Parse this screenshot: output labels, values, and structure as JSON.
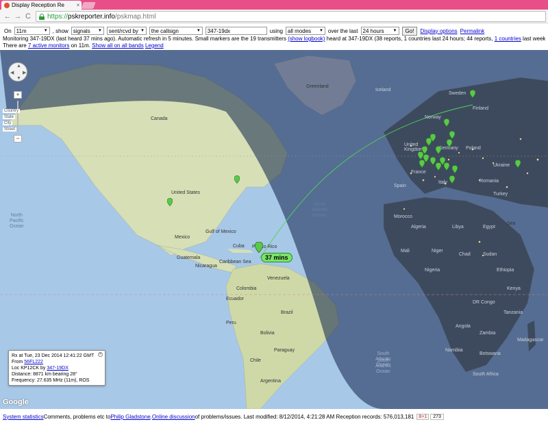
{
  "browser": {
    "tab_title": "Display Reception Re",
    "tab_close": "×",
    "url_scheme": "https://",
    "url_host": "pskreporter.info",
    "url_path": "/pskmap.html",
    "nav_back": "←",
    "nav_forward": "→",
    "nav_reload": "C"
  },
  "controls": {
    "on_label": "On",
    "band": "11m",
    "show_label": ", show",
    "show": "signals",
    "direction": "sent/rcvd by",
    "target": "the callsign",
    "callsign": "347-19dx",
    "using_label": "using",
    "mode": "all modes",
    "over_label": "over the last",
    "period": "24 hours",
    "go": "Go!",
    "display_options": "Display options",
    "permalink": "Permalink"
  },
  "info": {
    "line1_a": "Monitoring 347-19DX (last heard 37 mins ago). Automatic refresh in 5 minutes. Small markers are the 19 transmitters ",
    "line1_link": "(show logbook)",
    "line1_b": " heard at 347-19DX (38 reports, 1 countries last 24 hours; 44 reports, ",
    "line1_link2": "1 countries",
    "line1_c": " last week).",
    "line2_a": "There are ",
    "line2_link": "7 active monitors",
    "line2_b": " on 11m. ",
    "line2_link2": "Show all on all bands",
    "line2_link3": "Legend"
  },
  "map": {
    "labels": [
      {
        "text": "Greenland",
        "cls": ""
      },
      {
        "text": "Canada",
        "cls": ""
      },
      {
        "text": "United States",
        "cls": ""
      },
      {
        "text": "Mexico",
        "cls": ""
      },
      {
        "text": "Venezuela",
        "cls": ""
      },
      {
        "text": "Colombia",
        "cls": ""
      },
      {
        "text": "Peru",
        "cls": ""
      },
      {
        "text": "Brazil",
        "cls": ""
      },
      {
        "text": "Bolivia",
        "cls": ""
      },
      {
        "text": "Paraguay",
        "cls": ""
      },
      {
        "text": "Chile",
        "cls": ""
      },
      {
        "text": "Argentina",
        "cls": ""
      },
      {
        "text": "Ecuador",
        "cls": ""
      },
      {
        "text": "Cuba",
        "cls": ""
      },
      {
        "text": "Puerto Rico",
        "cls": ""
      },
      {
        "text": "Caribbean Sea",
        "cls": ""
      },
      {
        "text": "Gulf of Mexico",
        "cls": ""
      },
      {
        "text": "Guatemala",
        "cls": ""
      },
      {
        "text": "Nicaragua",
        "cls": ""
      },
      {
        "text": "North\nPacific\nOcean",
        "cls": "ocean"
      },
      {
        "text": "North\nAtlantic\nOcean",
        "cls": "ocean"
      },
      {
        "text": "South\nAtlantic\nOcean",
        "cls": "nocean"
      },
      {
        "text": "Iceland",
        "cls": "night"
      },
      {
        "text": "Sweden",
        "cls": "night"
      },
      {
        "text": "Finland",
        "cls": "night"
      },
      {
        "text": "Norway",
        "cls": "night"
      },
      {
        "text": "United\nKingdom",
        "cls": "night"
      },
      {
        "text": "Germany",
        "cls": "night"
      },
      {
        "text": "Poland",
        "cls": "night"
      },
      {
        "text": "Ukraine",
        "cls": "night"
      },
      {
        "text": "France",
        "cls": "night"
      },
      {
        "text": "Spain",
        "cls": "night"
      },
      {
        "text": "Italy",
        "cls": "night"
      },
      {
        "text": "Romania",
        "cls": "night"
      },
      {
        "text": "Turkey",
        "cls": "night"
      },
      {
        "text": "Morocco",
        "cls": "night"
      },
      {
        "text": "Algeria",
        "cls": "night"
      },
      {
        "text": "Libya",
        "cls": "night"
      },
      {
        "text": "Egypt",
        "cls": "night"
      },
      {
        "text": "Mali",
        "cls": "night"
      },
      {
        "text": "Niger",
        "cls": "night"
      },
      {
        "text": "Chad",
        "cls": "night"
      },
      {
        "text": "Sudan",
        "cls": "night"
      },
      {
        "text": "Nigeria",
        "cls": "night"
      },
      {
        "text": "Ethiopia",
        "cls": "night"
      },
      {
        "text": "Kenya",
        "cls": "night"
      },
      {
        "text": "DR Congo",
        "cls": "night"
      },
      {
        "text": "Tanzania",
        "cls": "night"
      },
      {
        "text": "Angola",
        "cls": "night"
      },
      {
        "text": "Zambia",
        "cls": "night"
      },
      {
        "text": "Namibia",
        "cls": "night"
      },
      {
        "text": "Botswana",
        "cls": "night"
      },
      {
        "text": "South Africa",
        "cls": "night"
      },
      {
        "text": "Madagascar",
        "cls": "night"
      },
      {
        "text": "South\nAtlantic\nOcean",
        "cls": "nocean"
      },
      {
        "text": "Sea",
        "cls": ""
      }
    ],
    "receiver_label": "37 mins",
    "google": "Google",
    "zoom_plus": "+",
    "zoom_minus": "−",
    "zoom_tick_1": "Country",
    "zoom_tick_2": "State",
    "zoom_tick_3": "City",
    "zoom_tick_4": "Street",
    "popup": {
      "line1": "Rx at Tue, 23 Dec 2014 12:41:22 GMT",
      "from_label": "From ",
      "from_call": "56FL222",
      "loc_label": "Loc KP12CK by ",
      "loc_call": "347-19DX",
      "distance": "Distance: 8871 km bearing 28°",
      "frequency": "Frequency: 27.635 MHz (11m), ROS",
      "close": "×"
    }
  },
  "footer": {
    "stats": "System statistics",
    "text1": " Comments, problems etc to ",
    "author": "Philip Gladstone",
    "text2": ". ",
    "discussion": "Online discussion",
    "text3": " of problems/issues. Last modified: 8/12/2014, 4:21:28 AM Reception records: 576,013,181",
    "gplus": "8+1",
    "count": "273"
  }
}
